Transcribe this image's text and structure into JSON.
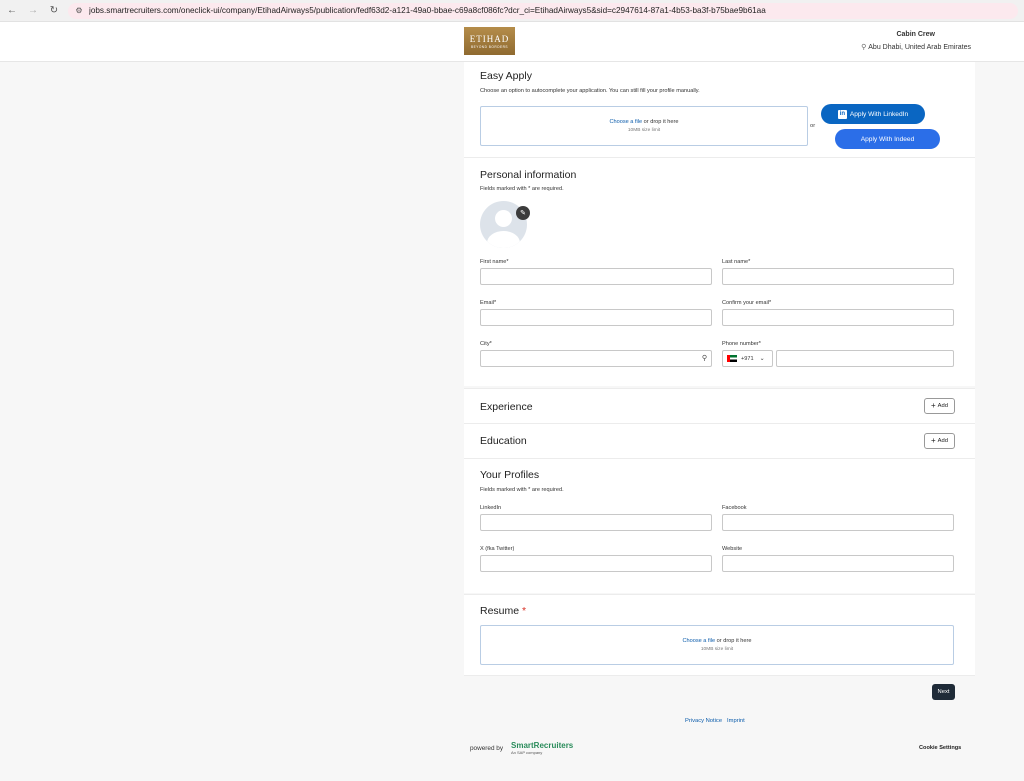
{
  "browser": {
    "url": "jobs.smartrecruiters.com/oneclick-ui/company/EtihadAirways5/publication/fedf63d2-a121-49a0-bbae-c69a8cf086fc?dcr_ci=EtihadAirways5&sid=c2947614-87a1-4b53-ba3f-b75bae9b61aa"
  },
  "header": {
    "logo_text": "ETIHAD",
    "logo_sub": "BEYOND BORDERS",
    "job_title": "Cabin Crew",
    "job_location": "Abu Dhabi, United Arab Emirates"
  },
  "easy_apply": {
    "title": "Easy Apply",
    "desc": "Choose an option to autocomplete your application. You can still fill your profile manually.",
    "dropzone_link": "Choose a file",
    "dropzone_text": " or drop it here",
    "dropzone_limit": "10MB size limit",
    "or": "or",
    "linkedin_label": "Apply With LinkedIn",
    "indeed_label": "Apply With Indeed"
  },
  "personal": {
    "title": "Personal information",
    "required_note": "Fields marked with * are required.",
    "first_name": "First name*",
    "last_name": "Last name*",
    "email": "Email*",
    "confirm_email": "Confirm your email*",
    "city": "City*",
    "phone": "Phone number*",
    "dial_code": "+971"
  },
  "experience": {
    "title": "Experience",
    "add_label": "Add"
  },
  "education": {
    "title": "Education",
    "add_label": "Add"
  },
  "profiles": {
    "title": "Your Profiles",
    "required_note": "Fields marked with * are required.",
    "linkedin": "LinkedIn",
    "facebook": "Facebook",
    "twitter": "X (fka Twitter)",
    "website": "Website"
  },
  "resume": {
    "title": "Resume",
    "star": "*",
    "dropzone_link": "Choose a file",
    "dropzone_text": " or drop it here",
    "dropzone_limit": "10MB size limit"
  },
  "footer": {
    "next_label": "Next",
    "privacy": "Privacy Notice",
    "imprint": "Imprint",
    "powered_by": "powered by",
    "sr_name": "SmartRecruiters",
    "sr_sub": "An SAP company",
    "cookie_settings": "Cookie Settings"
  },
  "colors": {
    "linkedin": "#0a66c2",
    "indeed": "#2b6ee8",
    "next": "#1f2b38",
    "link": "#0b5cab",
    "brand_gold": "#a67c3d"
  }
}
